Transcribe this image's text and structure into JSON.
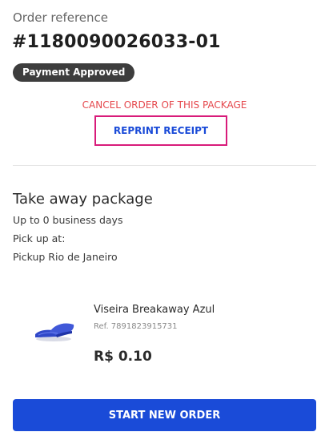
{
  "order": {
    "reference_label": "Order reference",
    "number": "#1180090026033-01",
    "status": "Payment Approved",
    "status_color": "#3d3d3d"
  },
  "actions": {
    "cancel_label": "CANCEL ORDER OF THIS PACKAGE",
    "cancel_color": "#e5484d",
    "reprint_label": "REPRINT RECEIPT",
    "reprint_border_color": "#d81b7a"
  },
  "delivery": {
    "title": "Take away package",
    "eta": "Up to 0 business days",
    "pickup_label": "Pick up at:",
    "pickup_location": "Pickup Rio de Janeiro"
  },
  "product": {
    "name": "Viseira Breakaway Azul",
    "ref": "Ref. 7891823915731",
    "price": "R$ 0.10",
    "image": "blue-visor-product-image"
  },
  "footer": {
    "primary_label": "START NEW ORDER",
    "primary_color": "#1a4bd8"
  }
}
